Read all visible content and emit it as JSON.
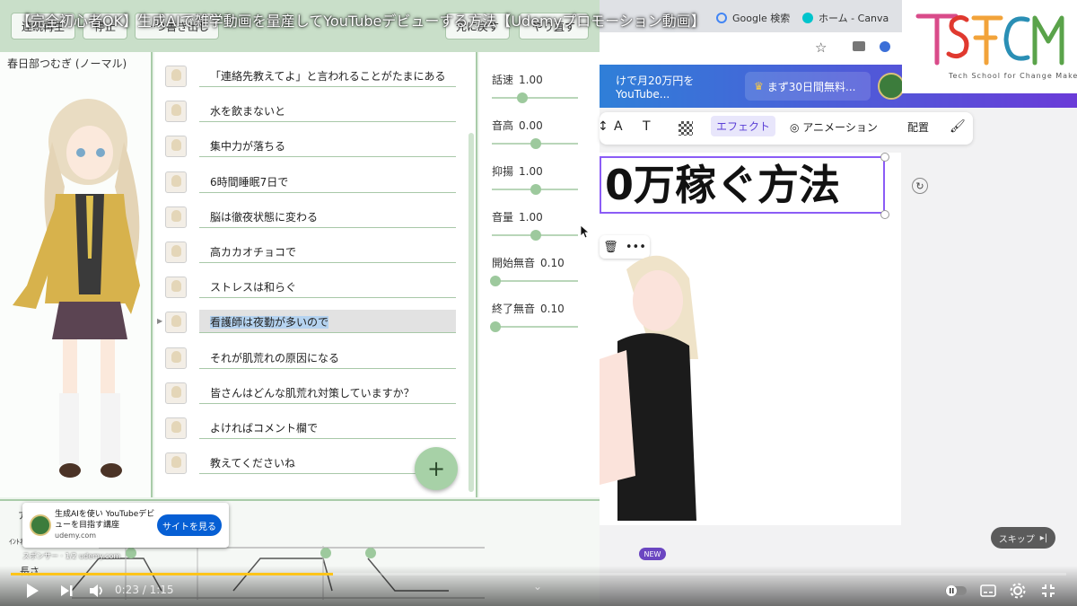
{
  "video": {
    "title": "【完全初心者OK】生成AIで雑学動画を量産してYouTubeデビューする方法【Udemyプロモーション動画】"
  },
  "left_app": {
    "toolbar": {
      "buttons": [
        "連続再生",
        "停止",
        "一つ書き出し",
        "元に戻す",
        "やり直す"
      ]
    },
    "character": "春日部つむぎ (ノーマル)",
    "lines": [
      {
        "text": "「連絡先教えてよ」と言われることがたまにある"
      },
      {
        "text": "水を飲まないと"
      },
      {
        "text": "集中力が落ちる"
      },
      {
        "text": "6時間睡眠7日で"
      },
      {
        "text": "脳は徹夜状態に変わる"
      },
      {
        "text": "高カカオチョコで"
      },
      {
        "text": "ストレスは和らぐ"
      },
      {
        "text": "看護師は夜勤が多いので"
      },
      {
        "text": "それが肌荒れの原因になる"
      },
      {
        "text": "皆さんはどんな肌荒れ対策していますか？"
      },
      {
        "text": "よければコメント欄で"
      },
      {
        "text": "教えてくださいね"
      }
    ],
    "selected_line": 7,
    "add_button": "+",
    "params": [
      {
        "label": "話速",
        "value": "1.00",
        "level": 0.33
      },
      {
        "label": "音高",
        "value": "0.00",
        "level": 0.5
      },
      {
        "label": "抑揚",
        "value": "1.00",
        "level": 0.5
      },
      {
        "label": "音量",
        "value": "1.00",
        "level": 0.5
      },
      {
        "label": "開始無音",
        "value": "0.10",
        "level": 0.0
      },
      {
        "label": "終了無音",
        "value": "0.10",
        "level": 0.0
      }
    ],
    "bottom": {
      "tab": "ア",
      "label_small": "ｲﾝﾄﾈ",
      "label_length": "長さ"
    }
  },
  "right_app": {
    "tabs": [
      {
        "label": "Google 検索"
      },
      {
        "label": "ホーム - Canva"
      }
    ],
    "promo": [
      "けで月20万円をYouTube...",
      "まず30日間無料..."
    ],
    "format_toolbar": [
      "A",
      "T",
      "エフェクト",
      "アニメーション",
      "配置"
    ],
    "headline": "0万稼ぐ方法",
    "mini_tools": [
      "🗑",
      "•••"
    ]
  },
  "ad": {
    "title": "生成AIを使い YouTubeデビューを目指す講座",
    "domain": "udemy.com",
    "button": "サイトを見る",
    "sponsor": "スポンサー · 1/2    udemy.com"
  },
  "brand": {
    "sub": "Tech School for Change Makers"
  },
  "player": {
    "time": "0:23 / 1:15",
    "progress": 0.305,
    "skip": "スキップ",
    "new_badge": "NEW"
  },
  "colors": {
    "accent": "#fcc419",
    "ad_button": "#065fd4",
    "app_green": "#a7d1a7"
  }
}
